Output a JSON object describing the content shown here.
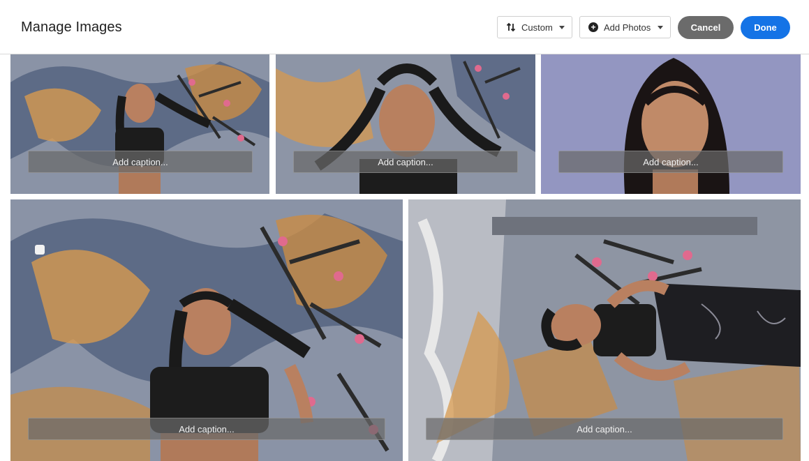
{
  "header": {
    "title": "Manage Images",
    "sort": {
      "label": "Custom",
      "icon": "sort-arrows-icon"
    },
    "add_photos": {
      "label": "Add Photos",
      "icon": "plus-circle-icon"
    },
    "cancel_label": "Cancel",
    "done_label": "Done",
    "colors": {
      "done": "#1473e6",
      "cancel": "#6b6b6b"
    }
  },
  "photos": [
    {
      "caption_placeholder": "Add caption..."
    },
    {
      "caption_placeholder": "Add caption..."
    },
    {
      "caption_placeholder": "Add caption..."
    },
    {
      "caption_placeholder": "Add caption..."
    },
    {
      "caption_placeholder": "Add caption..."
    }
  ]
}
